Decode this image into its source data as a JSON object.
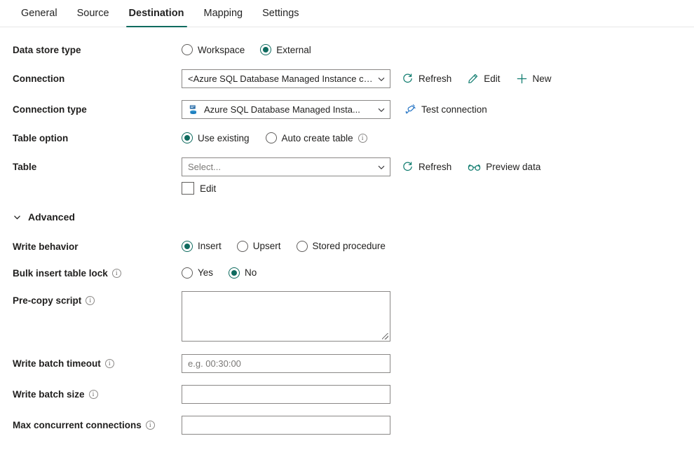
{
  "accent": "#0f6b5f",
  "icon_teal": "#107c6f",
  "icon_blue": "#1b6ec2",
  "tabs": [
    {
      "label": "General",
      "active": false
    },
    {
      "label": "Source",
      "active": false
    },
    {
      "label": "Destination",
      "active": true
    },
    {
      "label": "Mapping",
      "active": false
    },
    {
      "label": "Settings",
      "active": false
    }
  ],
  "fields": {
    "data_store_type": {
      "label": "Data store type",
      "options": [
        {
          "label": "Workspace",
          "selected": false
        },
        {
          "label": "External",
          "selected": true
        }
      ]
    },
    "connection": {
      "label": "Connection",
      "value": "<Azure SQL Database Managed Instance connection>",
      "commands": [
        {
          "label": "Refresh",
          "icon": "refresh-icon"
        },
        {
          "label": "Edit",
          "icon": "pencil-icon"
        },
        {
          "label": "New",
          "icon": "plus-icon"
        }
      ]
    },
    "connection_type": {
      "label": "Connection type",
      "value": "Azure SQL Database Managed Insta...",
      "icon": "sql-database-icon",
      "command": {
        "label": "Test connection",
        "icon": "plug-icon"
      }
    },
    "table_option": {
      "label": "Table option",
      "options": [
        {
          "label": "Use existing",
          "selected": true,
          "info": false
        },
        {
          "label": "Auto create table",
          "selected": false,
          "info": true
        }
      ]
    },
    "table": {
      "label": "Table",
      "placeholder": "Select...",
      "value": "",
      "commands": [
        {
          "label": "Refresh",
          "icon": "refresh-icon"
        },
        {
          "label": "Preview data",
          "icon": "glasses-icon"
        }
      ],
      "edit_checkbox": {
        "label": "Edit",
        "checked": false
      }
    },
    "advanced": {
      "label": "Advanced",
      "expanded": true,
      "icon": "chevron-down-icon"
    },
    "write_behavior": {
      "label": "Write behavior",
      "options": [
        {
          "label": "Insert",
          "selected": true
        },
        {
          "label": "Upsert",
          "selected": false
        },
        {
          "label": "Stored procedure",
          "selected": false
        }
      ]
    },
    "bulk_insert_table_lock": {
      "label": "Bulk insert table lock",
      "info": true,
      "options": [
        {
          "label": "Yes",
          "selected": false
        },
        {
          "label": "No",
          "selected": true
        }
      ]
    },
    "pre_copy_script": {
      "label": "Pre-copy script",
      "info": true,
      "value": ""
    },
    "write_batch_timeout": {
      "label": "Write batch timeout",
      "info": true,
      "placeholder": "e.g. 00:30:00",
      "value": ""
    },
    "write_batch_size": {
      "label": "Write batch size",
      "info": true,
      "placeholder": "",
      "value": ""
    },
    "max_concurrent_connections": {
      "label": "Max concurrent connections",
      "info": true,
      "placeholder": "",
      "value": ""
    }
  },
  "glyphs": {
    "info": "i"
  }
}
